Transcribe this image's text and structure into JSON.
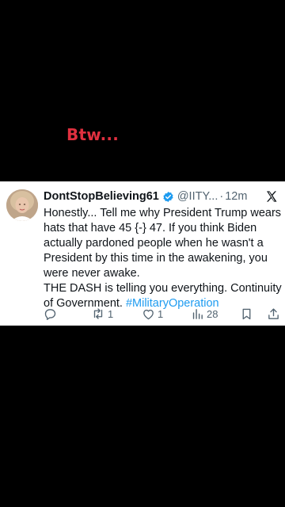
{
  "overlay": {
    "caption": "Btw..."
  },
  "tweet": {
    "display_name": "DontStopBelieving61",
    "handle": "@IITY...",
    "separator": "·",
    "time": "12m",
    "body_lines": [
      "Honestly...  Tell me why President Trump wears",
      "hats that have  45 {-} 47.  If you think Biden",
      "actually pardoned people when he wasn't a",
      "President by this time in the awakening, you",
      "were never awake.",
      "THE DASH is telling you everything. Continuity",
      "of Government. "
    ],
    "hashtag": "#MilitaryOperation",
    "actions": {
      "retweets": "1",
      "likes": "1",
      "views": "28"
    },
    "colors": {
      "accent": "#1d9bf0",
      "text": "#0f1419",
      "muted": "#536471",
      "caption": "#e0303f"
    },
    "icons": [
      "verified-badge-icon",
      "x-logo-icon",
      "reply-icon",
      "retweet-icon",
      "like-icon",
      "views-icon",
      "bookmark-icon",
      "share-icon"
    ]
  }
}
